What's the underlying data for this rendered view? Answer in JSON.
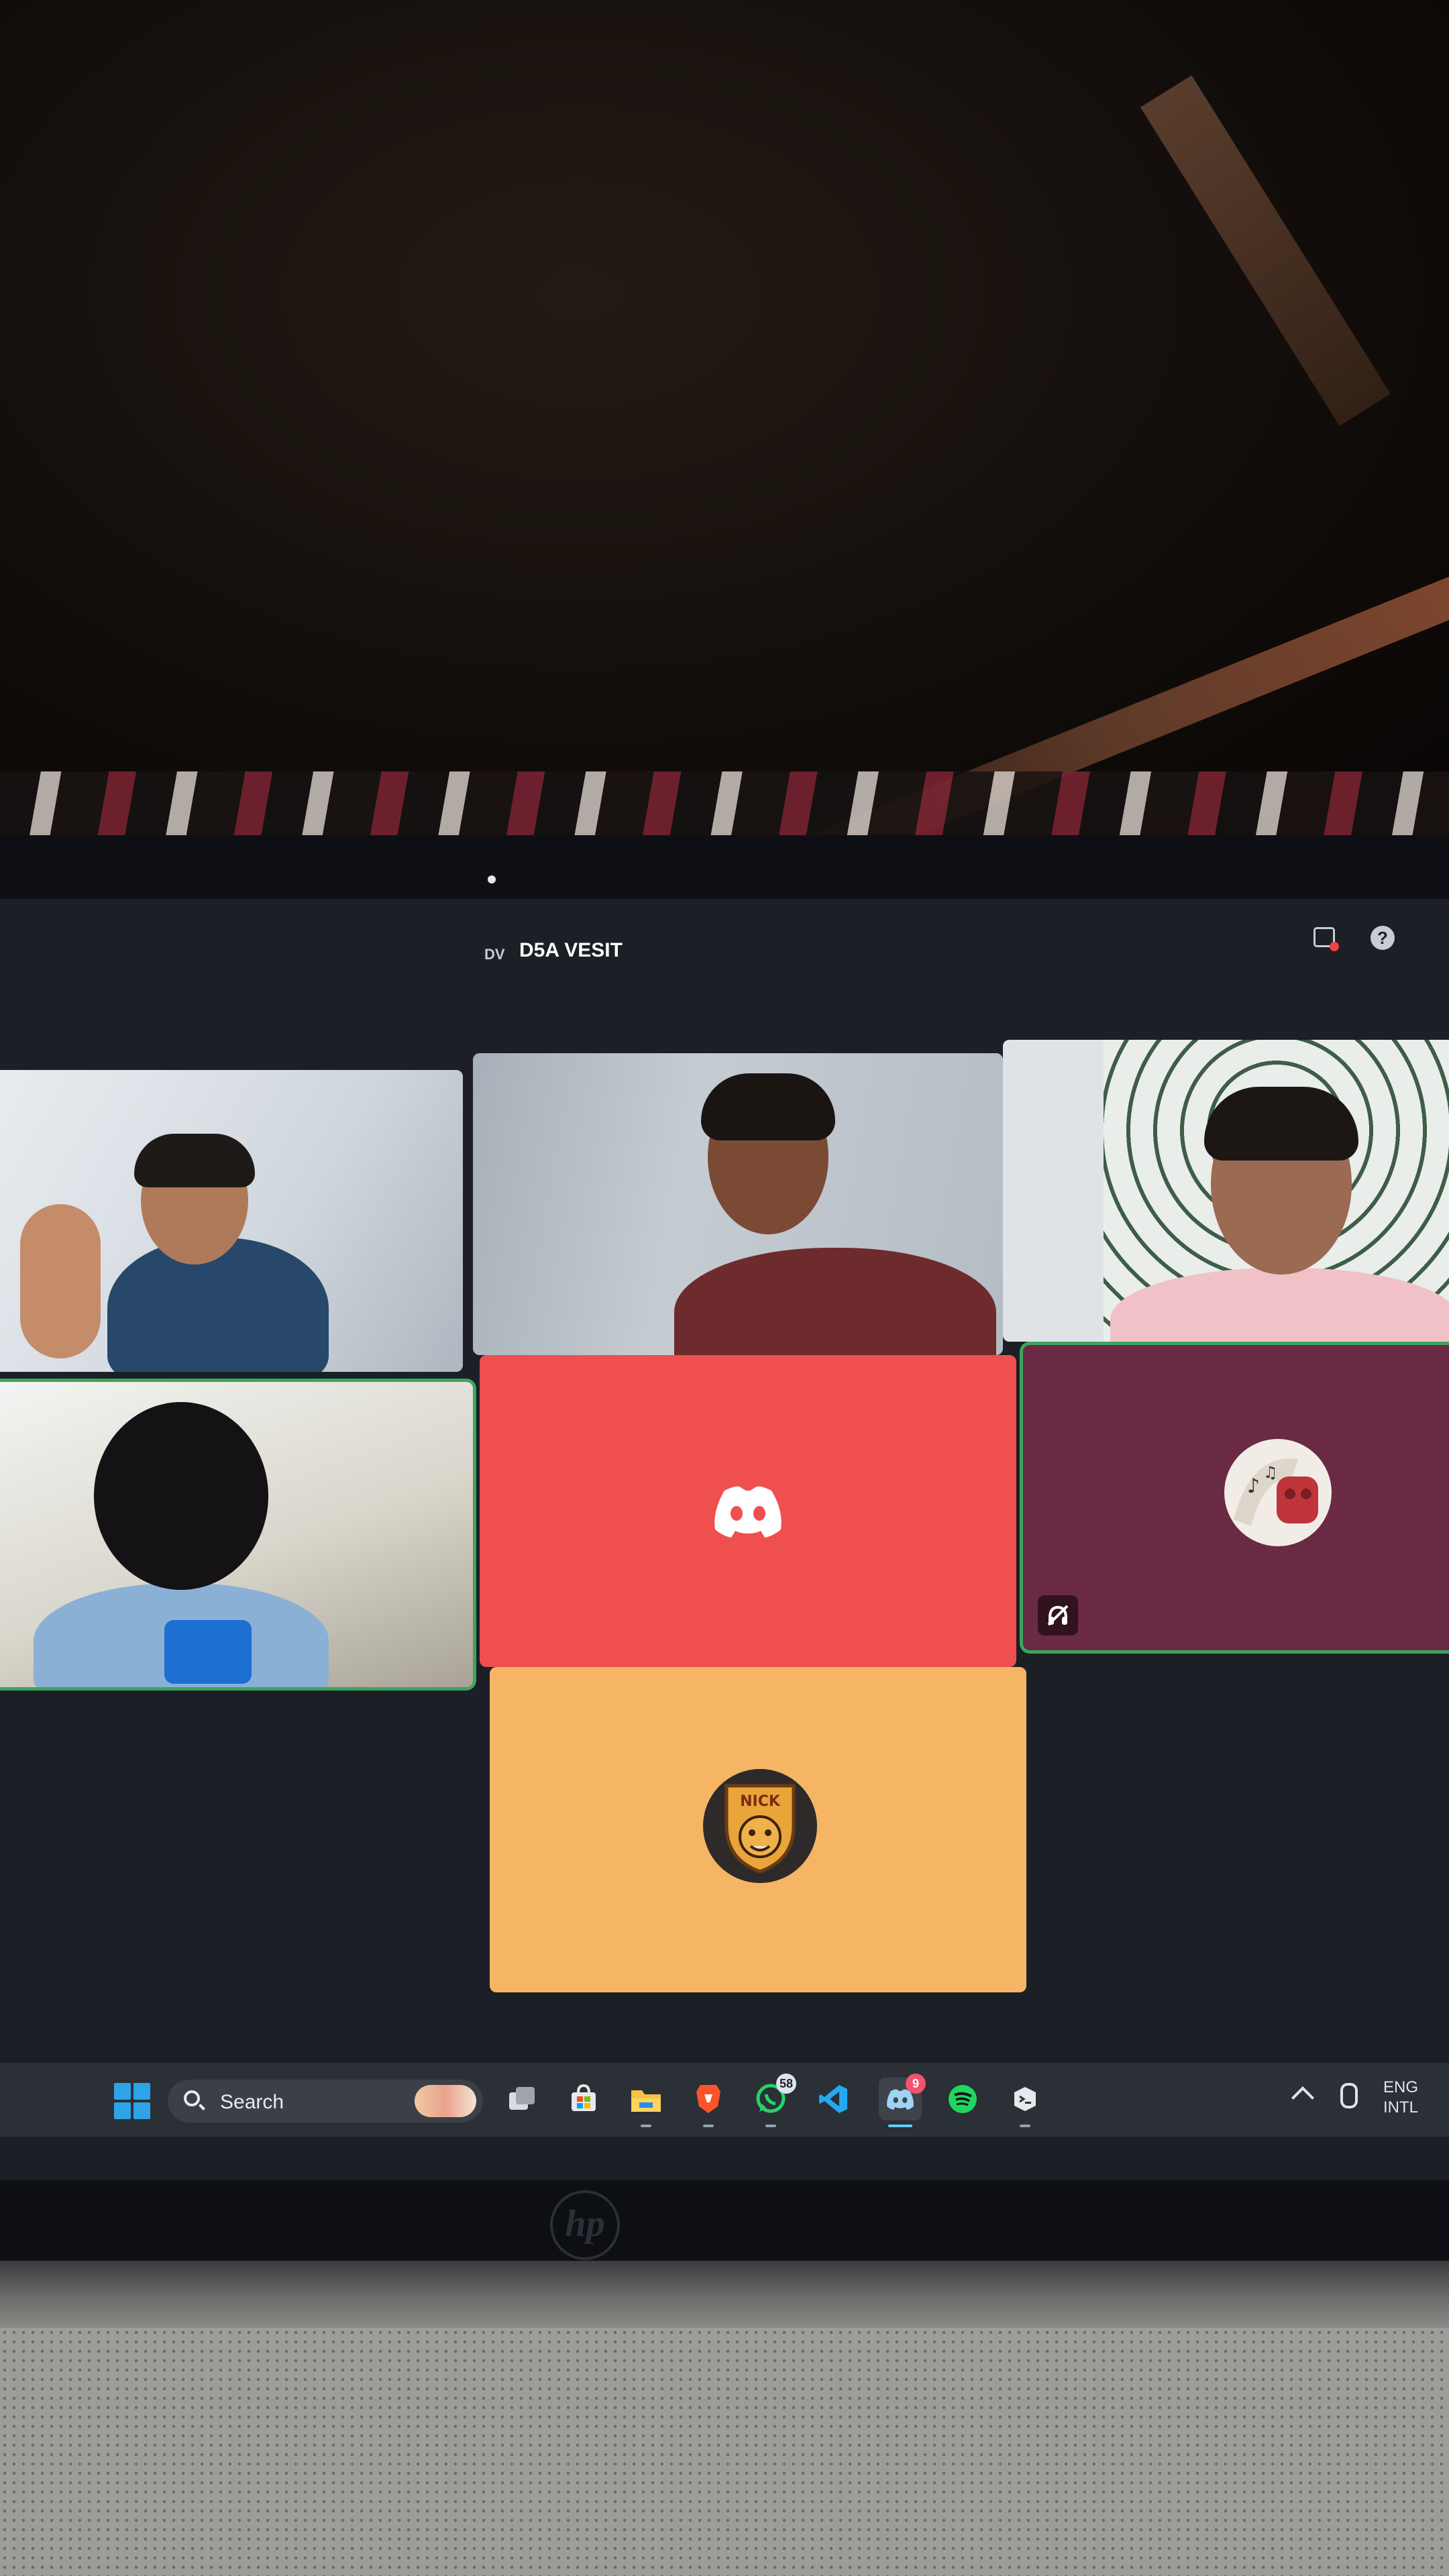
{
  "window": {
    "server_badge": "DV",
    "server_name": "D5A VESIT"
  },
  "call_tiles": [
    {
      "kind": "camera",
      "speaking": false,
      "muted": false
    },
    {
      "kind": "camera",
      "speaking": false,
      "muted": false
    },
    {
      "kind": "camera",
      "speaking": false,
      "muted": false
    },
    {
      "kind": "camera",
      "speaking": true,
      "muted": false
    },
    {
      "kind": "avatar",
      "avatar": "discord-logo-icon",
      "tile_color": "#ef4f4f",
      "speaking": false,
      "muted": false
    },
    {
      "kind": "avatar",
      "avatar": "music-avatar-icon",
      "tile_color": "#6a2a44",
      "speaking": true,
      "muted": true
    },
    {
      "kind": "avatar",
      "avatar": "tiger-avatar-icon",
      "tile_color": "#f5b565",
      "avatar_text": "NICK",
      "speaking": false,
      "muted": false
    }
  ],
  "taskbar": {
    "search_label": "Search",
    "apps": [
      {
        "name": "task-view-icon"
      },
      {
        "name": "microsoft-store-icon"
      },
      {
        "name": "file-explorer-icon"
      },
      {
        "name": "brave-browser-icon"
      },
      {
        "name": "whatsapp-icon",
        "badge": "58"
      },
      {
        "name": "vs-code-icon"
      },
      {
        "name": "discord-app-icon",
        "badge": "9",
        "active": true
      },
      {
        "name": "spotify-icon"
      },
      {
        "name": "terminal-icon"
      }
    ],
    "tray": {
      "lang_line1": "ENG",
      "lang_line2": "INTL"
    }
  },
  "colors": {
    "screen_bg": "#1c1f26",
    "speaking_ring": "#3ba55d",
    "taskbar_bg": "#2b2f36"
  }
}
